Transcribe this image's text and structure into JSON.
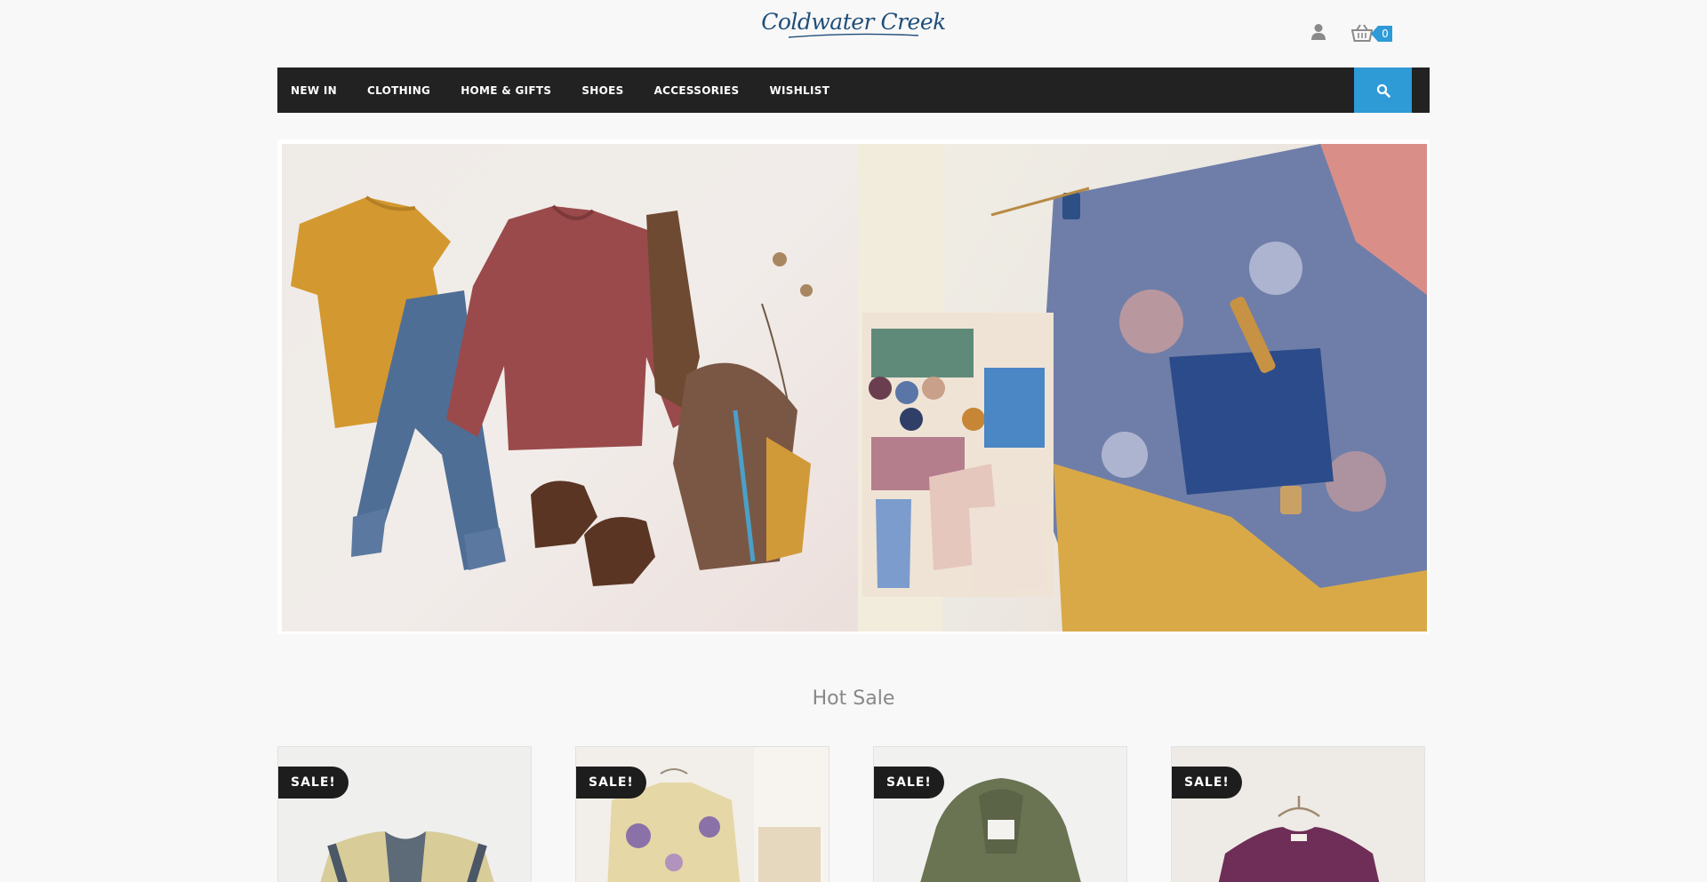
{
  "header": {
    "logo_text": "Coldwater Creek",
    "user_icon": "user-icon",
    "cart_icon": "basket-icon",
    "cart_count": "0"
  },
  "nav": {
    "items": [
      {
        "label": "NEW IN"
      },
      {
        "label": "CLOTHING"
      },
      {
        "label": "HOME & GIFTS"
      },
      {
        "label": "SHOES"
      },
      {
        "label": "ACCESSORIES"
      },
      {
        "label": "WISHLIST"
      }
    ],
    "search_icon": "search-icon"
  },
  "hero": {
    "image": "hero-banner-image"
  },
  "section": {
    "title": "Hot Sale"
  },
  "products": [
    {
      "badge": "SALE!",
      "image": "embroidered-tunic-image"
    },
    {
      "badge": "SALE!",
      "image": "floral-cardigan-image"
    },
    {
      "badge": "SALE!",
      "image": "green-hooded-jacket-image"
    },
    {
      "badge": "SALE!",
      "image": "plum-blouse-image"
    }
  ],
  "colors": {
    "nav_bg": "#222222",
    "accent": "#2e9ad6",
    "badge_bg": "#1d1d1d",
    "page_bg": "#f8f8f8"
  }
}
